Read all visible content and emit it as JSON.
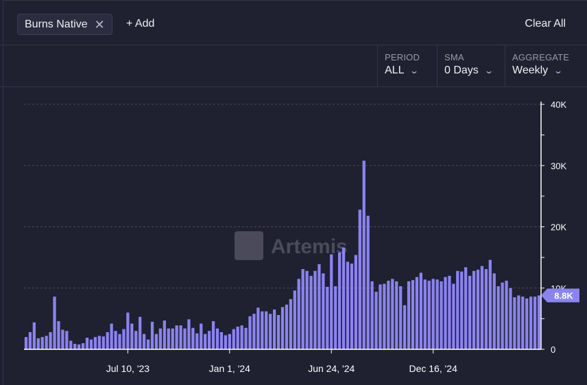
{
  "filter": {
    "chip_label": "Burns Native",
    "add_label": "+ Add",
    "clear_label": "Clear All"
  },
  "controls": [
    {
      "label": "PERIOD",
      "value": "ALL"
    },
    {
      "label": "SMA",
      "value": "0 Days"
    },
    {
      "label": "AGGREGATE",
      "value": "Weekly"
    }
  ],
  "watermark": "Artemis",
  "colors": {
    "bar": "#8b83f0",
    "background": "#1f2030",
    "grid": "#4a4b60",
    "axis": "#ffffff"
  },
  "chart_data": {
    "type": "bar",
    "xlabel": "",
    "ylabel": "",
    "ylim": [
      0,
      40000
    ],
    "y_ticks": [
      0,
      10000,
      20000,
      30000,
      40000
    ],
    "y_tick_labels": [
      "0",
      "10K",
      "20K",
      "30K",
      "40K"
    ],
    "x_tick_labels": [
      "Jul 10, '23",
      "Jan 1, '24",
      "Jun 24, '24",
      "Dec 16, '24"
    ],
    "x_tick_indices": [
      25,
      50,
      75,
      100
    ],
    "last_value_label": "8.8K",
    "grid": true,
    "values": [
      2000,
      2800,
      4400,
      1800,
      2000,
      2200,
      2800,
      8600,
      4600,
      3200,
      3000,
      1400,
      900,
      800,
      1000,
      1900,
      1600,
      2000,
      2200,
      2100,
      2800,
      4200,
      3000,
      2500,
      3300,
      6000,
      4200,
      3000,
      5300,
      2500,
      1600,
      4500,
      2500,
      3400,
      4700,
      3400,
      3400,
      3900,
      3900,
      3400,
      4900,
      3500,
      2600,
      4200,
      2500,
      3000,
      4600,
      3400,
      2800,
      2300,
      2500,
      3300,
      3700,
      3900,
      3500,
      5400,
      5800,
      6800,
      6200,
      6200,
      5800,
      6500,
      5600,
      6900,
      7300,
      8200,
      9600,
      11500,
      13100,
      12800,
      12000,
      12800,
      13900,
      12400,
      10200,
      15500,
      10300,
      15800,
      16600,
      14300,
      14000,
      15400,
      22800,
      30800,
      21800,
      11100,
      9400,
      10600,
      10700,
      11200,
      11500,
      11100,
      10300,
      7200,
      11100,
      11300,
      11800,
      12500,
      11400,
      11200,
      11500,
      11400,
      11100,
      11800,
      12000,
      10700,
      12800,
      12700,
      13400,
      12000,
      12800,
      13000,
      13600,
      13100,
      14600,
      12400,
      10300,
      10900,
      11200,
      10000,
      8500,
      8800,
      8600,
      8300,
      8600,
      8600,
      8800
    ]
  }
}
